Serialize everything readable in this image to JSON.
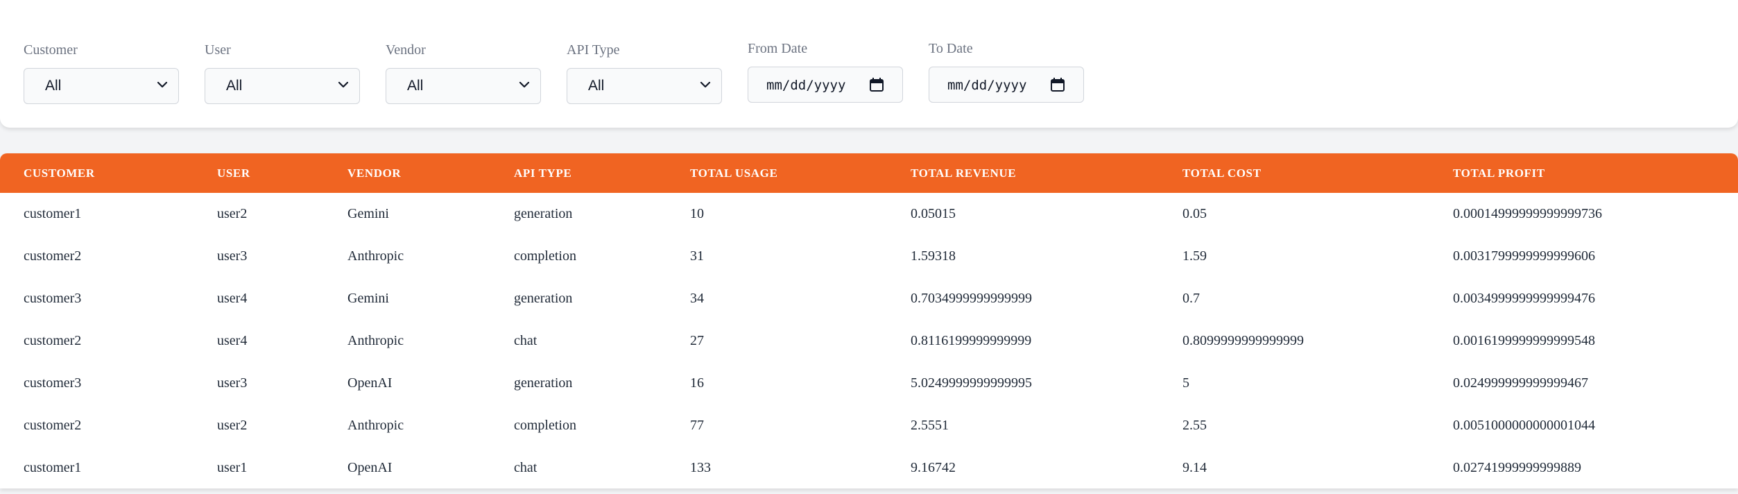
{
  "filters": {
    "customer": {
      "label": "Customer",
      "value": "All"
    },
    "user": {
      "label": "User",
      "value": "All"
    },
    "vendor": {
      "label": "Vendor",
      "value": "All"
    },
    "api_type": {
      "label": "API Type",
      "value": "All"
    },
    "from_date": {
      "label": "From Date",
      "placeholder": "mm/dd/yyyy"
    },
    "to_date": {
      "label": "To Date",
      "placeholder": "mm/dd/yyyy"
    }
  },
  "icons": {
    "select": "chevron-down-icon",
    "date": "calendar-icon"
  },
  "colors": {
    "header_accent": "#f06422",
    "header_text": "#ffffff",
    "body_text": "#1f2937",
    "label_text": "#6b7280"
  },
  "table": {
    "columns": [
      "Customer",
      "User",
      "Vendor",
      "API Type",
      "Total Usage",
      "Total Revenue",
      "Total Cost",
      "Total Profit"
    ],
    "rows": [
      [
        "customer1",
        "user2",
        "Gemini",
        "generation",
        "10",
        "0.05015",
        "0.05",
        "0.00014999999999999736"
      ],
      [
        "customer2",
        "user3",
        "Anthropic",
        "completion",
        "31",
        "1.59318",
        "1.59",
        "0.0031799999999999606"
      ],
      [
        "customer3",
        "user4",
        "Gemini",
        "generation",
        "34",
        "0.7034999999999999",
        "0.7",
        "0.0034999999999999476"
      ],
      [
        "customer2",
        "user4",
        "Anthropic",
        "chat",
        "27",
        "0.8116199999999999",
        "0.8099999999999999",
        "0.0016199999999999548"
      ],
      [
        "customer3",
        "user3",
        "OpenAI",
        "generation",
        "16",
        "5.0249999999999995",
        "5",
        "0.024999999999999467"
      ],
      [
        "customer2",
        "user2",
        "Anthropic",
        "completion",
        "77",
        "2.5551",
        "2.55",
        "0.0051000000000001044"
      ],
      [
        "customer1",
        "user1",
        "OpenAI",
        "chat",
        "133",
        "9.16742",
        "9.14",
        "0.02741999999999889"
      ]
    ]
  }
}
